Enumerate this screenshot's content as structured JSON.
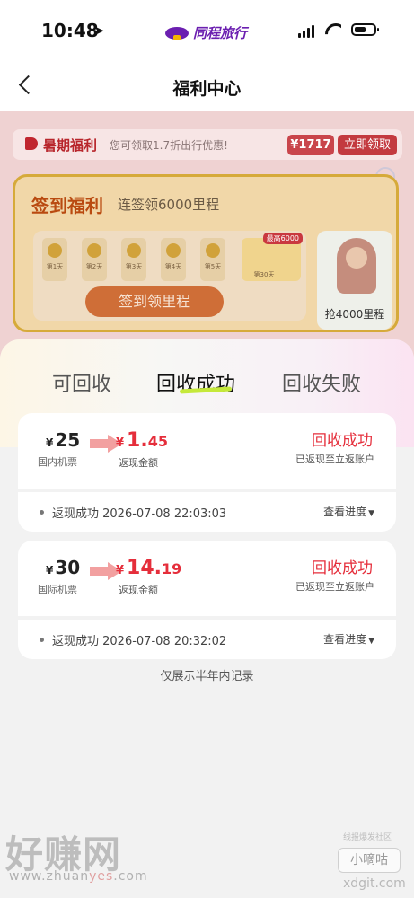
{
  "status_bar": {
    "time": "10:48",
    "brand": "同程旅行"
  },
  "nav": {
    "title": "福利中心"
  },
  "background": {
    "banner": {
      "title": "暑期福利",
      "desc": "您可领取1.7折出行优惠!",
      "price": "¥1717",
      "button": "立即领取"
    },
    "checkin": {
      "title": "签到福利",
      "subtitle": "连签领6000里程",
      "days": [
        "第1天",
        "第2天",
        "第3天",
        "第4天",
        "第5天"
      ],
      "day30": "第30天",
      "max_tag": "最高6000",
      "button": "签到领里程",
      "side_label": "抢4000里程"
    }
  },
  "tabs": [
    "可回收",
    "回收成功",
    "回收失败"
  ],
  "active_tab": "回收成功",
  "records": [
    {
      "amount_currency": "¥",
      "amount": "25",
      "amount_label": "国内机票",
      "cash_currency": "¥",
      "cash_int": "1.",
      "cash_dec": "45",
      "cash_label": "返现金额",
      "status": "回收成功",
      "status_desc": "已返现至立返账户",
      "time": "返现成功 2026-07-08 22:03:03",
      "progress": "查看进度"
    },
    {
      "amount_currency": "¥",
      "amount": "30",
      "amount_label": "国际机票",
      "cash_currency": "¥",
      "cash_int": "14.",
      "cash_dec": "19",
      "cash_label": "返现金额",
      "status": "回收成功",
      "status_desc": "已返现至立返账户",
      "time": "返现成功 2026-07-08 20:32:02",
      "progress": "查看进度"
    }
  ],
  "note": "仅展示半年内记录",
  "watermark": {
    "logo": "好赚网",
    "url_prefix": "www.zhuan",
    "url_yes": "yes",
    "url_suffix": ".com",
    "small": "线报爆发社区",
    "badge": "小嘀咕",
    "domain": "xdgit.com"
  }
}
